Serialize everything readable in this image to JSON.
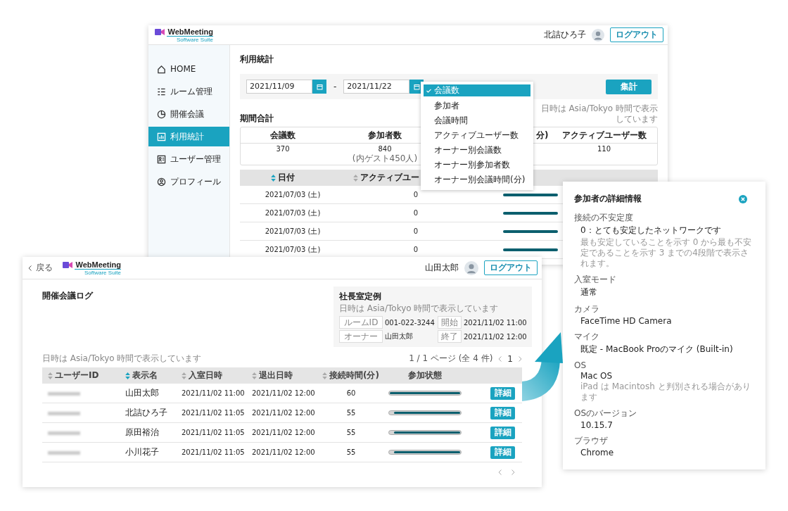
{
  "back_window": {
    "logo": {
      "name": "WebMeeting",
      "tagline": "Software Suite"
    },
    "user_name": "北詰ひろ子",
    "logout_button": "ログアウト",
    "sidebar": [
      {
        "label": "HOME",
        "selected": false
      },
      {
        "label": "ルーム管理",
        "selected": false
      },
      {
        "label": "開催会議",
        "selected": false
      },
      {
        "label": "利用統計",
        "selected": true
      },
      {
        "label": "ユーザー管理",
        "selected": false
      },
      {
        "label": "プロフィール",
        "selected": false
      }
    ],
    "page_title": "利用統計",
    "filter": {
      "start_date": "2021/11/09",
      "separator": "-",
      "end_date": "2021/11/22",
      "submit_button": "集計",
      "dropdown": [
        {
          "label": "会議数",
          "selected": true
        },
        {
          "label": "参加者",
          "selected": false
        },
        {
          "label": "会議時間",
          "selected": false
        },
        {
          "label": "アクティブユーザー数",
          "selected": false
        },
        {
          "label": "オーナー別会議数",
          "selected": false
        },
        {
          "label": "オーナー別参加者数",
          "selected": false
        },
        {
          "label": "オーナー別会議時間(分)",
          "selected": false
        }
      ]
    },
    "summary": {
      "title": "期間合計",
      "note": "日時は Asia/Tokyo 時間で表示しています",
      "cells": [
        {
          "heading": "会議数",
          "value": "370"
        },
        {
          "heading": "参加者数",
          "value": "840",
          "sub": "(内ゲスト450人)"
        },
        {
          "heading": "分)"
        },
        {
          "heading": "アクティブユーザー数",
          "value": "110"
        }
      ]
    },
    "table": {
      "columns": [
        {
          "label": "日付",
          "sorted": true
        },
        {
          "label": "アクティブユー",
          "sorted": false
        }
      ],
      "rows": [
        {
          "date": "2021/07/03 (土)",
          "count": "0"
        },
        {
          "date": "2021/07/03 (土)",
          "count": "0"
        },
        {
          "date": "2021/07/03 (土)",
          "count": "0"
        },
        {
          "date": "2021/07/03 (土)",
          "count": "0"
        }
      ]
    }
  },
  "log_window": {
    "back_link": "戻る",
    "logo": {
      "name": "WebMeeting",
      "tagline": "Software Suite"
    },
    "user_name": "山田太郎",
    "logout_button": "ログアウト",
    "page_title": "開催会議ログ",
    "meeting": {
      "title": "社長室定例",
      "note": "日時は Asia/Tokyo 時間で表示しています",
      "fields": [
        {
          "label": "ルームID",
          "value": "001-022-3244"
        },
        {
          "label": "開始",
          "value": "2021/11/02 11:00"
        },
        {
          "label": "オーナー",
          "value": "山田太郎"
        },
        {
          "label": "終了",
          "value": "2021/11/02 12:00"
        }
      ]
    },
    "note": "日時は Asia/Tokyo 時間で表示しています",
    "pagination": {
      "summary": "1 / 1 ページ (全 4 件)",
      "page": "1"
    },
    "table": {
      "columns": [
        {
          "label": "ユーザーID",
          "sortable": true,
          "sorted": false
        },
        {
          "label": "表示名",
          "sortable": true,
          "sorted": true
        },
        {
          "label": "入室日時",
          "sortable": true,
          "sorted": false
        },
        {
          "label": "退出日時",
          "sortable": true,
          "sorted": false
        },
        {
          "label": "接続時間(分)",
          "sortable": true,
          "sorted": false
        },
        {
          "label": "参加状態",
          "sortable": false
        }
      ],
      "rows": [
        {
          "name": "山田太郎",
          "entered": "2021/11/02 11:00",
          "left": "2021/11/02 12:00",
          "minutes": "60",
          "level": 1,
          "button": "詳細"
        },
        {
          "name": "北詰ひろ子",
          "entered": "2021/11/02 11:05",
          "left": "2021/11/02 12:00",
          "minutes": "55",
          "level": 0.94,
          "button": "詳細"
        },
        {
          "name": "原田裕治",
          "entered": "2021/11/02 11:05",
          "left": "2021/11/02 12:00",
          "minutes": "55",
          "level": 0.94,
          "button": "詳細"
        },
        {
          "name": "小川花子",
          "entered": "2021/11/02 11:05",
          "left": "2021/11/02 12:00",
          "minutes": "55",
          "level": 0.94,
          "button": "詳細"
        }
      ]
    }
  },
  "detail_panel": {
    "title": "参加者の詳細情報",
    "fields": [
      {
        "label": "接続の不安定度",
        "value": "0：とても安定したネットワークです",
        "note": "最も安定していることを示す 0 から最も不安定であることを示す 3 までの4段階で表示されます。"
      },
      {
        "label": "入室モード",
        "value": "通常"
      },
      {
        "label": "カメラ",
        "value": "FaceTime HD Camera"
      },
      {
        "label": "マイク",
        "value": "既定 - MacBook Proのマイク (Built-in)"
      },
      {
        "label": "OS",
        "value": "Mac OS",
        "note": "iPad は Macintosh と判別される場合があります"
      },
      {
        "label": "OSのバージョン",
        "value": "10.15.7"
      },
      {
        "label": "ブラウザ",
        "value": "Chrome"
      }
    ]
  }
}
